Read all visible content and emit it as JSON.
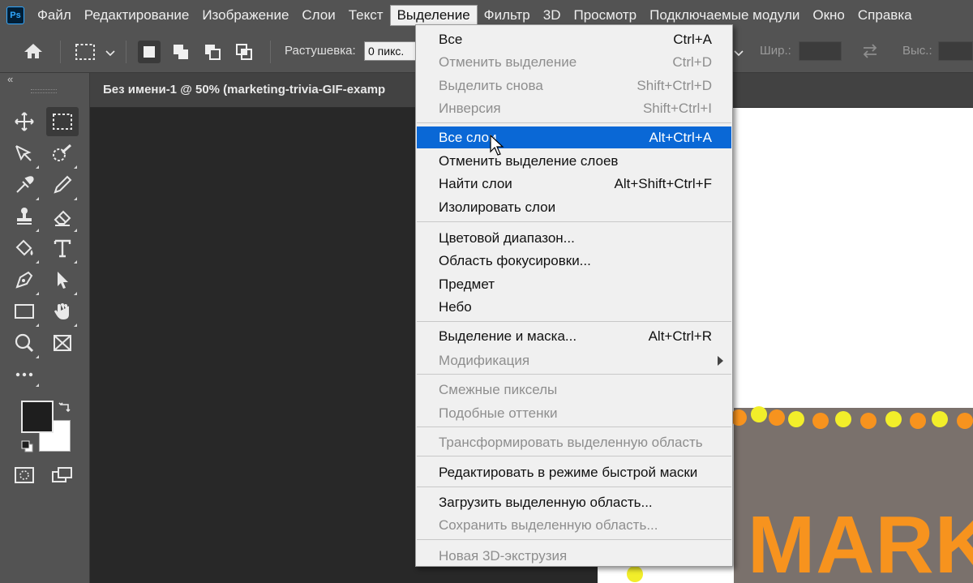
{
  "app": {
    "logo": "Ps"
  },
  "menubar": [
    "Файл",
    "Редактирование",
    "Изображение",
    "Слои",
    "Текст",
    "Выделение",
    "Фильтр",
    "3D",
    "Просмотр",
    "Подключаемые модули",
    "Окно",
    "Справка"
  ],
  "options": {
    "feather_label": "Растушевка:",
    "feather_value": "0 пикс.",
    "width_label": "Шир.:",
    "height_label": "Выс.:"
  },
  "document": {
    "tab_title": "Без имени-1 @ 50% (marketing-trivia-GIF-examp",
    "canvas_text": "MARK"
  },
  "select_menu": {
    "items": [
      {
        "label": "Все",
        "shortcut": "Ctrl+A",
        "disabled": false
      },
      {
        "label": "Отменить выделение",
        "shortcut": "Ctrl+D",
        "disabled": true
      },
      {
        "label": "Выделить снова",
        "shortcut": "Shift+Ctrl+D",
        "disabled": true
      },
      {
        "label": "Инверсия",
        "shortcut": "Shift+Ctrl+I",
        "disabled": true
      },
      {
        "label": "Все слои",
        "shortcut": "Alt+Ctrl+A",
        "highlighted": true
      },
      {
        "label": "Отменить выделение слоев",
        "shortcut": ""
      },
      {
        "label": "Найти слои",
        "shortcut": "Alt+Shift+Ctrl+F"
      },
      {
        "label": "Изолировать слои",
        "shortcut": ""
      },
      {
        "label": "Цветовой диапазон...",
        "shortcut": ""
      },
      {
        "label": "Область фокусировки...",
        "shortcut": ""
      },
      {
        "label": "Предмет",
        "shortcut": ""
      },
      {
        "label": "Небо",
        "shortcut": ""
      },
      {
        "label": "Выделение и маска...",
        "shortcut": "Alt+Ctrl+R"
      },
      {
        "label": "Модификация",
        "shortcut": "",
        "disabled": true,
        "submenu": true
      },
      {
        "label": "Смежные пикселы",
        "shortcut": "",
        "disabled": true
      },
      {
        "label": "Подобные оттенки",
        "shortcut": "",
        "disabled": true
      },
      {
        "label": "Трансформировать выделенную область",
        "shortcut": "",
        "disabled": true
      },
      {
        "label": "Редактировать в режиме быстрой маски",
        "shortcut": ""
      },
      {
        "label": "Загрузить выделенную область...",
        "shortcut": ""
      },
      {
        "label": "Сохранить выделенную область...",
        "shortcut": "",
        "disabled": true
      },
      {
        "label": "Новая 3D-экструзия",
        "shortcut": "",
        "disabled": true
      }
    ]
  },
  "colors": {
    "highlight": "#0a68d6",
    "foreground_swatch": "#1e1e1e",
    "background_swatch": "#ffffff",
    "accent_orange": "#f7931e",
    "accent_yellow": "#f2ee2a"
  }
}
